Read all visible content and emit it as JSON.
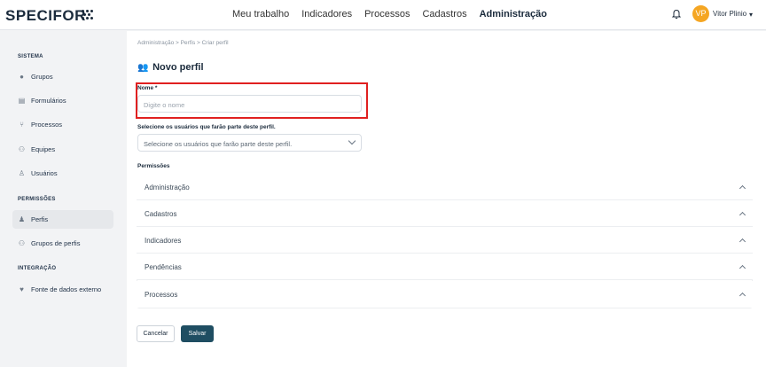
{
  "app": {
    "logo": "SPECIFOR"
  },
  "nav": [
    "Meu trabalho",
    "Indicadores",
    "Processos",
    "Cadastros",
    "Administração"
  ],
  "nav_active": "Administração",
  "user": {
    "initials": "VP",
    "name": "Vitor Plinio",
    "chevron": "▾",
    "avatar_color": "#f5a623"
  },
  "sidebar": {
    "sections": [
      {
        "title": "SISTEMA",
        "items": [
          {
            "label": "Grupos",
            "icon": "tag-icon"
          },
          {
            "label": "Formulários",
            "icon": "clipboard-icon"
          },
          {
            "label": "Processos",
            "icon": "flow-icon"
          },
          {
            "label": "Equipes",
            "icon": "team-icon"
          },
          {
            "label": "Usuários",
            "icon": "user-icon"
          }
        ]
      },
      {
        "title": "PERMISSÕES",
        "items": [
          {
            "label": "Perfis",
            "icon": "profile-icon",
            "active": true
          },
          {
            "label": "Grupos de perfis",
            "icon": "profiles-group-icon"
          }
        ]
      },
      {
        "title": "INTEGRAÇÃO",
        "items": [
          {
            "label": "Fonte de dados externo",
            "icon": "plug-icon"
          }
        ]
      }
    ]
  },
  "breadcrumb": "Administração  >  Perfis  >  Criar perfil",
  "page_title": "Novo perfil",
  "form": {
    "name_label": "Nome *",
    "name_placeholder": "Digite o nome",
    "users_label": "Selecione os usuários que farão parte deste perfil.",
    "users_placeholder": "Selecione os usuários que farão parte deste perfil.",
    "permissions_label": "Permissões",
    "permissions": [
      "Administração",
      "Cadastros",
      "Indicadores",
      "Pendências",
      "Processos"
    ]
  },
  "buttons": {
    "cancel": "Cancelar",
    "save": "Salvar"
  },
  "colors": {
    "primary": "#1f4e62",
    "highlight": "#e02020"
  }
}
